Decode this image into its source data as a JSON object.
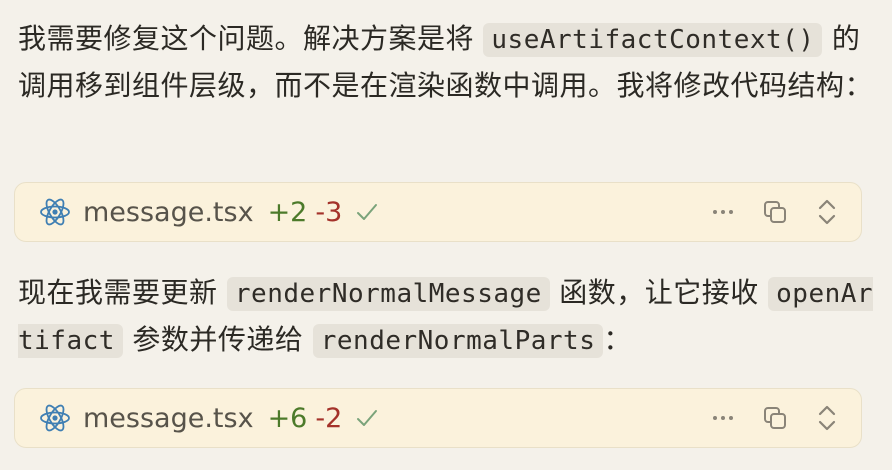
{
  "messages": [
    {
      "text_parts": [
        "我需要修复这个问题。解决方案是将 ",
        "useArtifactContext()",
        " 的调用移到组件层级，而不是在渲染函数中调用。我将修改代码结构："
      ]
    },
    {
      "text_parts": [
        "现在我需要更新 ",
        "renderNormalMessage",
        " 函数，让它接收 ",
        "openArtifact",
        " 参数并传递给 ",
        "renderNormalParts",
        "："
      ]
    }
  ],
  "file_cards": [
    {
      "filename": "message.tsx",
      "added": "+2",
      "removed": "-3",
      "file_icon": "react-icon",
      "status_icon": "check-icon",
      "actions": [
        "more-icon",
        "copy-icon",
        "expand-collapse-icon"
      ]
    },
    {
      "filename": "message.tsx",
      "added": "+6",
      "removed": "-2",
      "file_icon": "react-icon",
      "status_icon": "check-icon",
      "actions": [
        "more-icon",
        "copy-icon",
        "expand-collapse-icon"
      ]
    }
  ],
  "colors": {
    "background": "#f4f1ea",
    "card_background": "#fbf2dc",
    "added": "#4c7a2a",
    "removed": "#a4322a",
    "react_icon": "#3f7fb3",
    "check": "#7aa37a"
  }
}
